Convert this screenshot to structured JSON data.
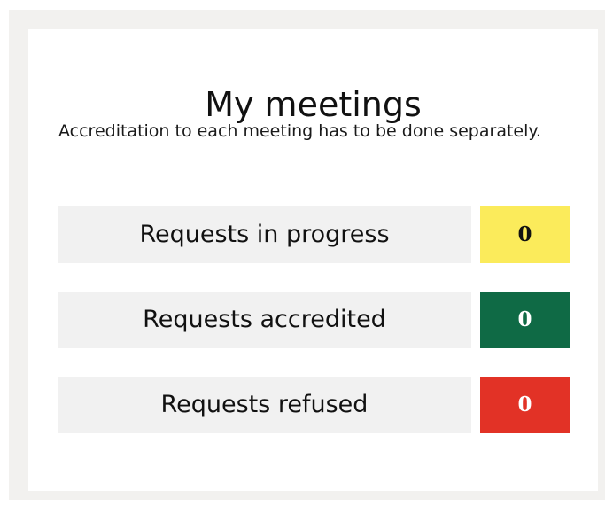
{
  "page": {
    "title": "My meetings",
    "intro": "Accreditation to each meeting has to be done separately."
  },
  "requests": [
    {
      "label": "Requests in progress",
      "count": "0",
      "color": "#fbeb5b",
      "text_color": "#111111"
    },
    {
      "label": "Requests accredited",
      "count": "0",
      "color": "#0f6a45",
      "text_color": "#ffffff"
    },
    {
      "label": "Requests refused",
      "count": "0",
      "color": "#e23226",
      "text_color": "#ffffff"
    }
  ]
}
